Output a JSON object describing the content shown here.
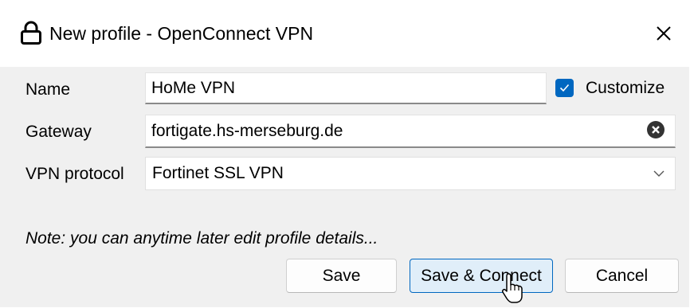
{
  "window": {
    "title": "New profile - OpenConnect VPN",
    "title_icon": "lock-icon",
    "close_icon": "close-icon"
  },
  "form": {
    "name": {
      "label": "Name",
      "value": "HoMe VPN"
    },
    "customize": {
      "label": "Customize",
      "checked": true
    },
    "gateway": {
      "label": "Gateway",
      "value": "fortigate.hs-merseburg.de",
      "clear_icon": "clear-circle-icon"
    },
    "protocol": {
      "label": "VPN protocol",
      "selected": "Fortinet SSL VPN",
      "dropdown_icon": "chevron-down-icon"
    }
  },
  "note": "Note: you can anytime later edit profile details...",
  "buttons": {
    "save": "Save",
    "save_connect": "Save & Connect",
    "cancel": "Cancel"
  },
  "colors": {
    "accent": "#0067c0",
    "content_bg": "#f0f0f0",
    "primary_button_bg": "#e0eef9"
  }
}
